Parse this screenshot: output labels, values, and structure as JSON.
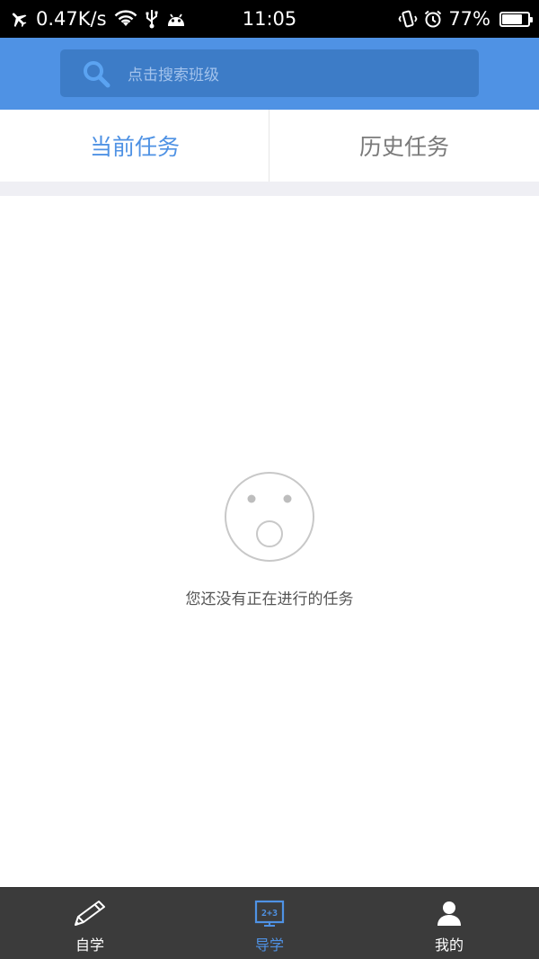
{
  "status_bar": {
    "network_speed": "0.47K/s",
    "time": "11:05",
    "battery": "77%",
    "battery_level": 0.77,
    "icons": [
      "airplane-icon",
      "wifi-icon",
      "usb-icon",
      "android-icon",
      "vibrate-icon",
      "alarm-icon",
      "battery-icon"
    ]
  },
  "search": {
    "placeholder": "点击搜索班级",
    "icon": "search-icon"
  },
  "tabs": [
    {
      "label": "当前任务",
      "active": true
    },
    {
      "label": "历史任务",
      "active": false
    }
  ],
  "empty_state": {
    "icon": "surprised-face-icon",
    "message": "您还没有正在进行的任务"
  },
  "bottom_nav": [
    {
      "label": "自学",
      "icon": "pencil-icon",
      "active": false
    },
    {
      "label": "导学",
      "icon": "blackboard-icon",
      "active": true
    },
    {
      "label": "我的",
      "icon": "user-icon",
      "active": false
    }
  ],
  "colors": {
    "accent": "#4f92e4",
    "search_bg": "#3d7cc7",
    "nav_bg": "#3b3b3b",
    "status_bg": "#000000"
  }
}
